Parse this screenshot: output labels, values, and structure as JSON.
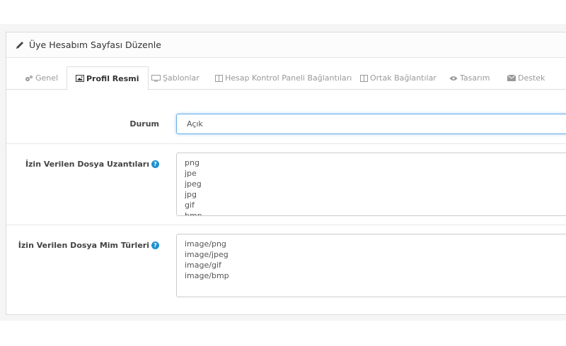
{
  "panel": {
    "title": "Üye Hesabım Sayfası Düzenle"
  },
  "tabs": [
    {
      "label": "Genel",
      "icon": "cogs-icon"
    },
    {
      "label": "Profil Resmi",
      "icon": "image-icon"
    },
    {
      "label": "Şablonlar",
      "icon": "desktop-icon"
    },
    {
      "label": "Hesap Kontrol Paneli Bağlantıları",
      "icon": "columns-icon"
    },
    {
      "label": "Ortak Bağlantılar",
      "icon": "columns-icon"
    },
    {
      "label": "Tasarım",
      "icon": "eye-icon"
    },
    {
      "label": "Destek",
      "icon": "envelope-icon"
    }
  ],
  "form": {
    "status": {
      "label": "Durum",
      "value": "Açık"
    },
    "extensions": {
      "label": "İzin Verilen Dosya Uzantıları",
      "values": [
        "png",
        "jpe",
        "jpeg",
        "jpg",
        "gif",
        "bmp"
      ]
    },
    "mimes": {
      "label": "İzin Verilen Dosya Mim Türleri",
      "values": [
        "image/png",
        "image/jpeg",
        "image/gif",
        "image/bmp"
      ]
    }
  },
  "colors": {
    "accent": "#1e91cf",
    "focus": "#66afe9"
  }
}
